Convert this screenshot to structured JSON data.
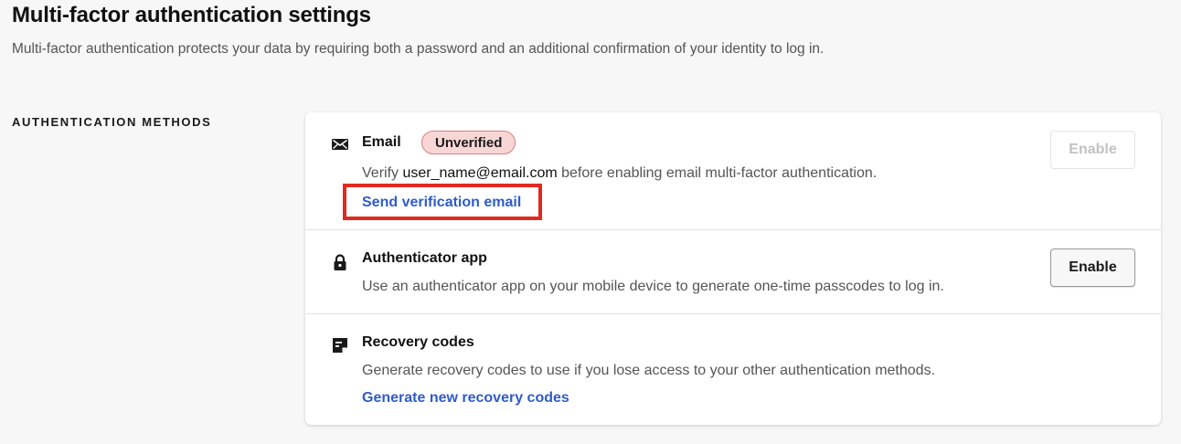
{
  "header": {
    "title": "Multi-factor authentication settings",
    "description": "Multi-factor authentication protects your data by requiring both a password and an additional confirmation of your identity to log in."
  },
  "section": {
    "label": "AUTHENTICATION METHODS"
  },
  "methods": {
    "email": {
      "icon": "envelope-icon",
      "title": "Email",
      "badge": "Unverified",
      "desc_prefix": "Verify ",
      "email_address": "user_name@email.com",
      "desc_suffix": " before enabling email multi-factor authentication.",
      "link": "Send verification email",
      "button": "Enable",
      "button_disabled": true
    },
    "authenticator": {
      "icon": "lock-icon",
      "title": "Authenticator app",
      "desc": "Use an authenticator app on your mobile device to generate one-time passcodes to log in.",
      "button": "Enable"
    },
    "recovery": {
      "icon": "recovery-codes-icon",
      "title": "Recovery codes",
      "desc": "Generate recovery codes to use if you lose access to your other authentication methods.",
      "link": "Generate new recovery codes"
    }
  },
  "colors": {
    "link": "#2f5cc9",
    "badge_bg": "#f9d6d6",
    "badge_border": "#e07c7c",
    "highlight": "#e02a22"
  }
}
